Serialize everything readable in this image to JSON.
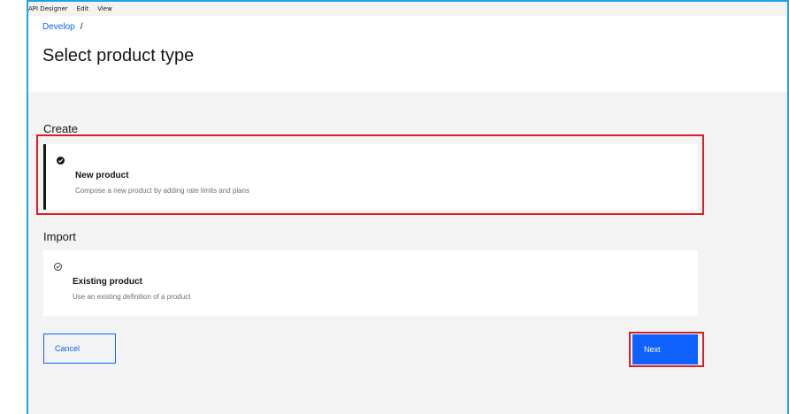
{
  "menubar": {
    "app": "API Designer",
    "edit": "Edit",
    "view": "View"
  },
  "breadcrumb": {
    "develop": "Develop",
    "separator": "/"
  },
  "page": {
    "title": "Select product type"
  },
  "sections": {
    "create": {
      "label": "Create",
      "tile": {
        "title": "New product",
        "description": "Compose a new product by adding rate limits and plans",
        "selected": true
      }
    },
    "import": {
      "label": "Import",
      "tile": {
        "title": "Existing product",
        "description": "Use an existing definition of a product",
        "selected": false
      }
    }
  },
  "actions": {
    "cancel": "Cancel",
    "next": "Next"
  },
  "colors": {
    "accent": "#0f62fe",
    "highlight": "#da1e28",
    "window_border": "#1ea1e8"
  }
}
